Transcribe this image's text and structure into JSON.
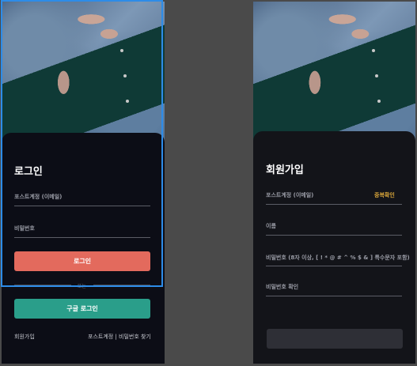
{
  "login": {
    "title": "로그인",
    "email_label": "포스트계정 (이메일)",
    "password_label": "비밀번호",
    "login_button": "로그인",
    "divider_text": "또는",
    "google_button": "구글 로그인",
    "signup_link": "회원가입",
    "find_links": "포스트계정 | 비밀번호 찾기"
  },
  "signup": {
    "title": "회원가입",
    "email_label": "포스트계정 (이메일)",
    "dup_check": "중복확인",
    "name_label": "이름",
    "password_label": "비밀번호 (8자 이상, [ ! * @ # ^ % $ & ] 특수문자 포함)",
    "password_confirm_label": "비밀번호 확인",
    "submit_button": ""
  },
  "colors": {
    "accent_login": "#e36a5d",
    "accent_google": "#2a9e8a",
    "dup_check": "#d9a63a",
    "selection": "#2d8ce8"
  }
}
